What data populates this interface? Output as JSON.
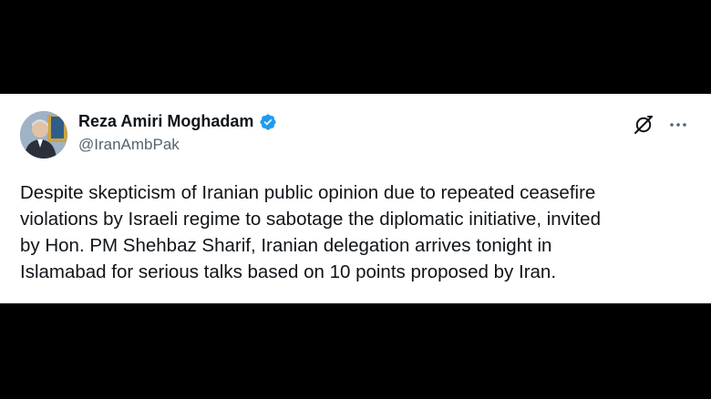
{
  "tweet": {
    "author": {
      "display_name": "Reza Amiri Moghadam",
      "handle": "@IranAmbPak",
      "verified": true,
      "verified_color": "#1d9bf0"
    },
    "icons": {
      "grok": "grok-icon",
      "more": "more-options-icon"
    },
    "body_lines": [
      "Despite skepticism of Iranian public opinion due to repeated ceasefire",
      "violations by Israeli regime to sabotage the diplomatic initiative, invited",
      "by Hon. PM Shehbaz Sharif, Iranian delegation arrives tonight in",
      "Islamabad for serious talks based on 10 points proposed by Iran."
    ]
  }
}
